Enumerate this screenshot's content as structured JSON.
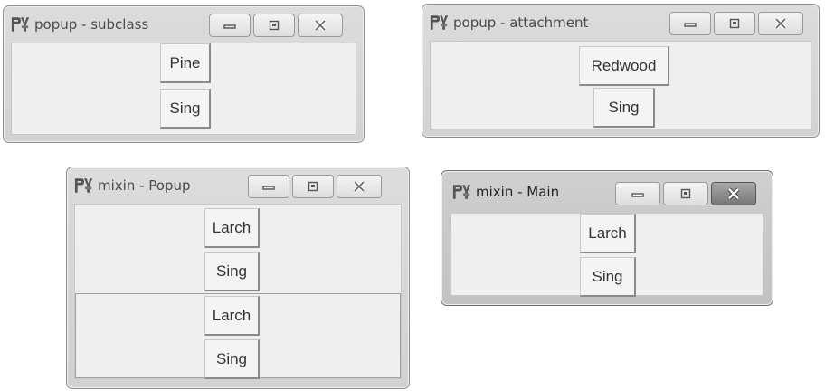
{
  "windows": [
    {
      "id": "w1",
      "title": "popup - subclass",
      "buttons": [
        "Pine",
        "Sing"
      ]
    },
    {
      "id": "w2",
      "title": "popup - attachment",
      "buttons": [
        "Redwood",
        "Sing"
      ]
    },
    {
      "id": "w3",
      "title": "mixin - Popup",
      "buttons": [
        "Larch",
        "Sing",
        "Larch",
        "Sing"
      ]
    },
    {
      "id": "w4",
      "title": "mixin - Main",
      "buttons": [
        "Larch",
        "Sing"
      ]
    }
  ],
  "controls": {
    "minimize_icon": "minimize-icon",
    "maximize_icon": "maximize-icon",
    "close_icon": "close-icon",
    "app_icon": "python-tk-icon"
  }
}
